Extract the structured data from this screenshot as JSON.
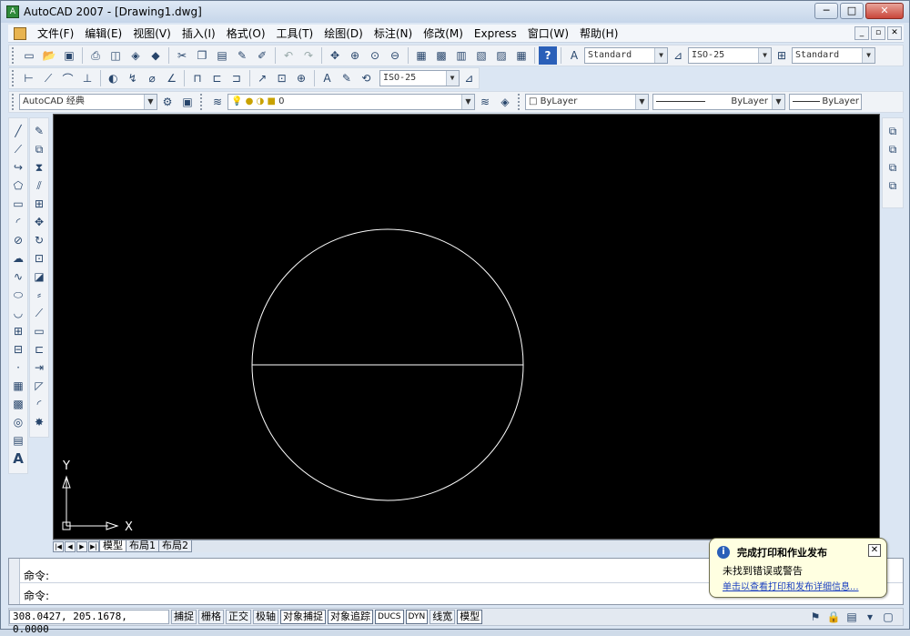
{
  "window": {
    "title": "AutoCAD 2007 - [Drawing1.dwg]",
    "app_icon": "A",
    "minimize": "─",
    "maximize": "□",
    "close": "✕"
  },
  "menu": {
    "items": [
      "文件(F)",
      "编辑(E)",
      "视图(V)",
      "插入(I)",
      "格式(O)",
      "工具(T)",
      "绘图(D)",
      "标注(N)",
      "修改(M)",
      "Express",
      "窗口(W)",
      "帮助(H)"
    ],
    "mdi": [
      "_",
      "▫",
      "✕"
    ]
  },
  "toolbar1": {
    "text_style": "Standard",
    "dim_style": "ISO-25",
    "table_style": "Standard"
  },
  "toolbar2": {
    "dim_style": "ISO-25"
  },
  "toolbar3": {
    "workspace": "AutoCAD 经典",
    "layer": "0",
    "color": "ByLayer",
    "linetype": "ByLayer",
    "lineweight": "ByLayer"
  },
  "canvas": {
    "background": "#000000",
    "stroke": "#ffffff",
    "ucs_x": "X",
    "ucs_y": "Y"
  },
  "layout_tabs": {
    "nav": [
      "|◀",
      "◀",
      "▶",
      "▶|"
    ],
    "tabs": [
      "模型",
      "布局1",
      "布局2"
    ]
  },
  "command": {
    "line1": "命令:",
    "line2": "命令:"
  },
  "status": {
    "coords": "308.0427, 205.1678, 0.0000",
    "buttons": [
      "捕捉",
      "栅格",
      "正交",
      "极轴",
      "对象捕捉",
      "对象追踪",
      "DUCS",
      "DYN",
      "线宽",
      "模型"
    ]
  },
  "balloon": {
    "title": "完成打印和作业发布",
    "message": "未找到错误或警告",
    "link": "单击以查看打印和发布详细信息..."
  }
}
